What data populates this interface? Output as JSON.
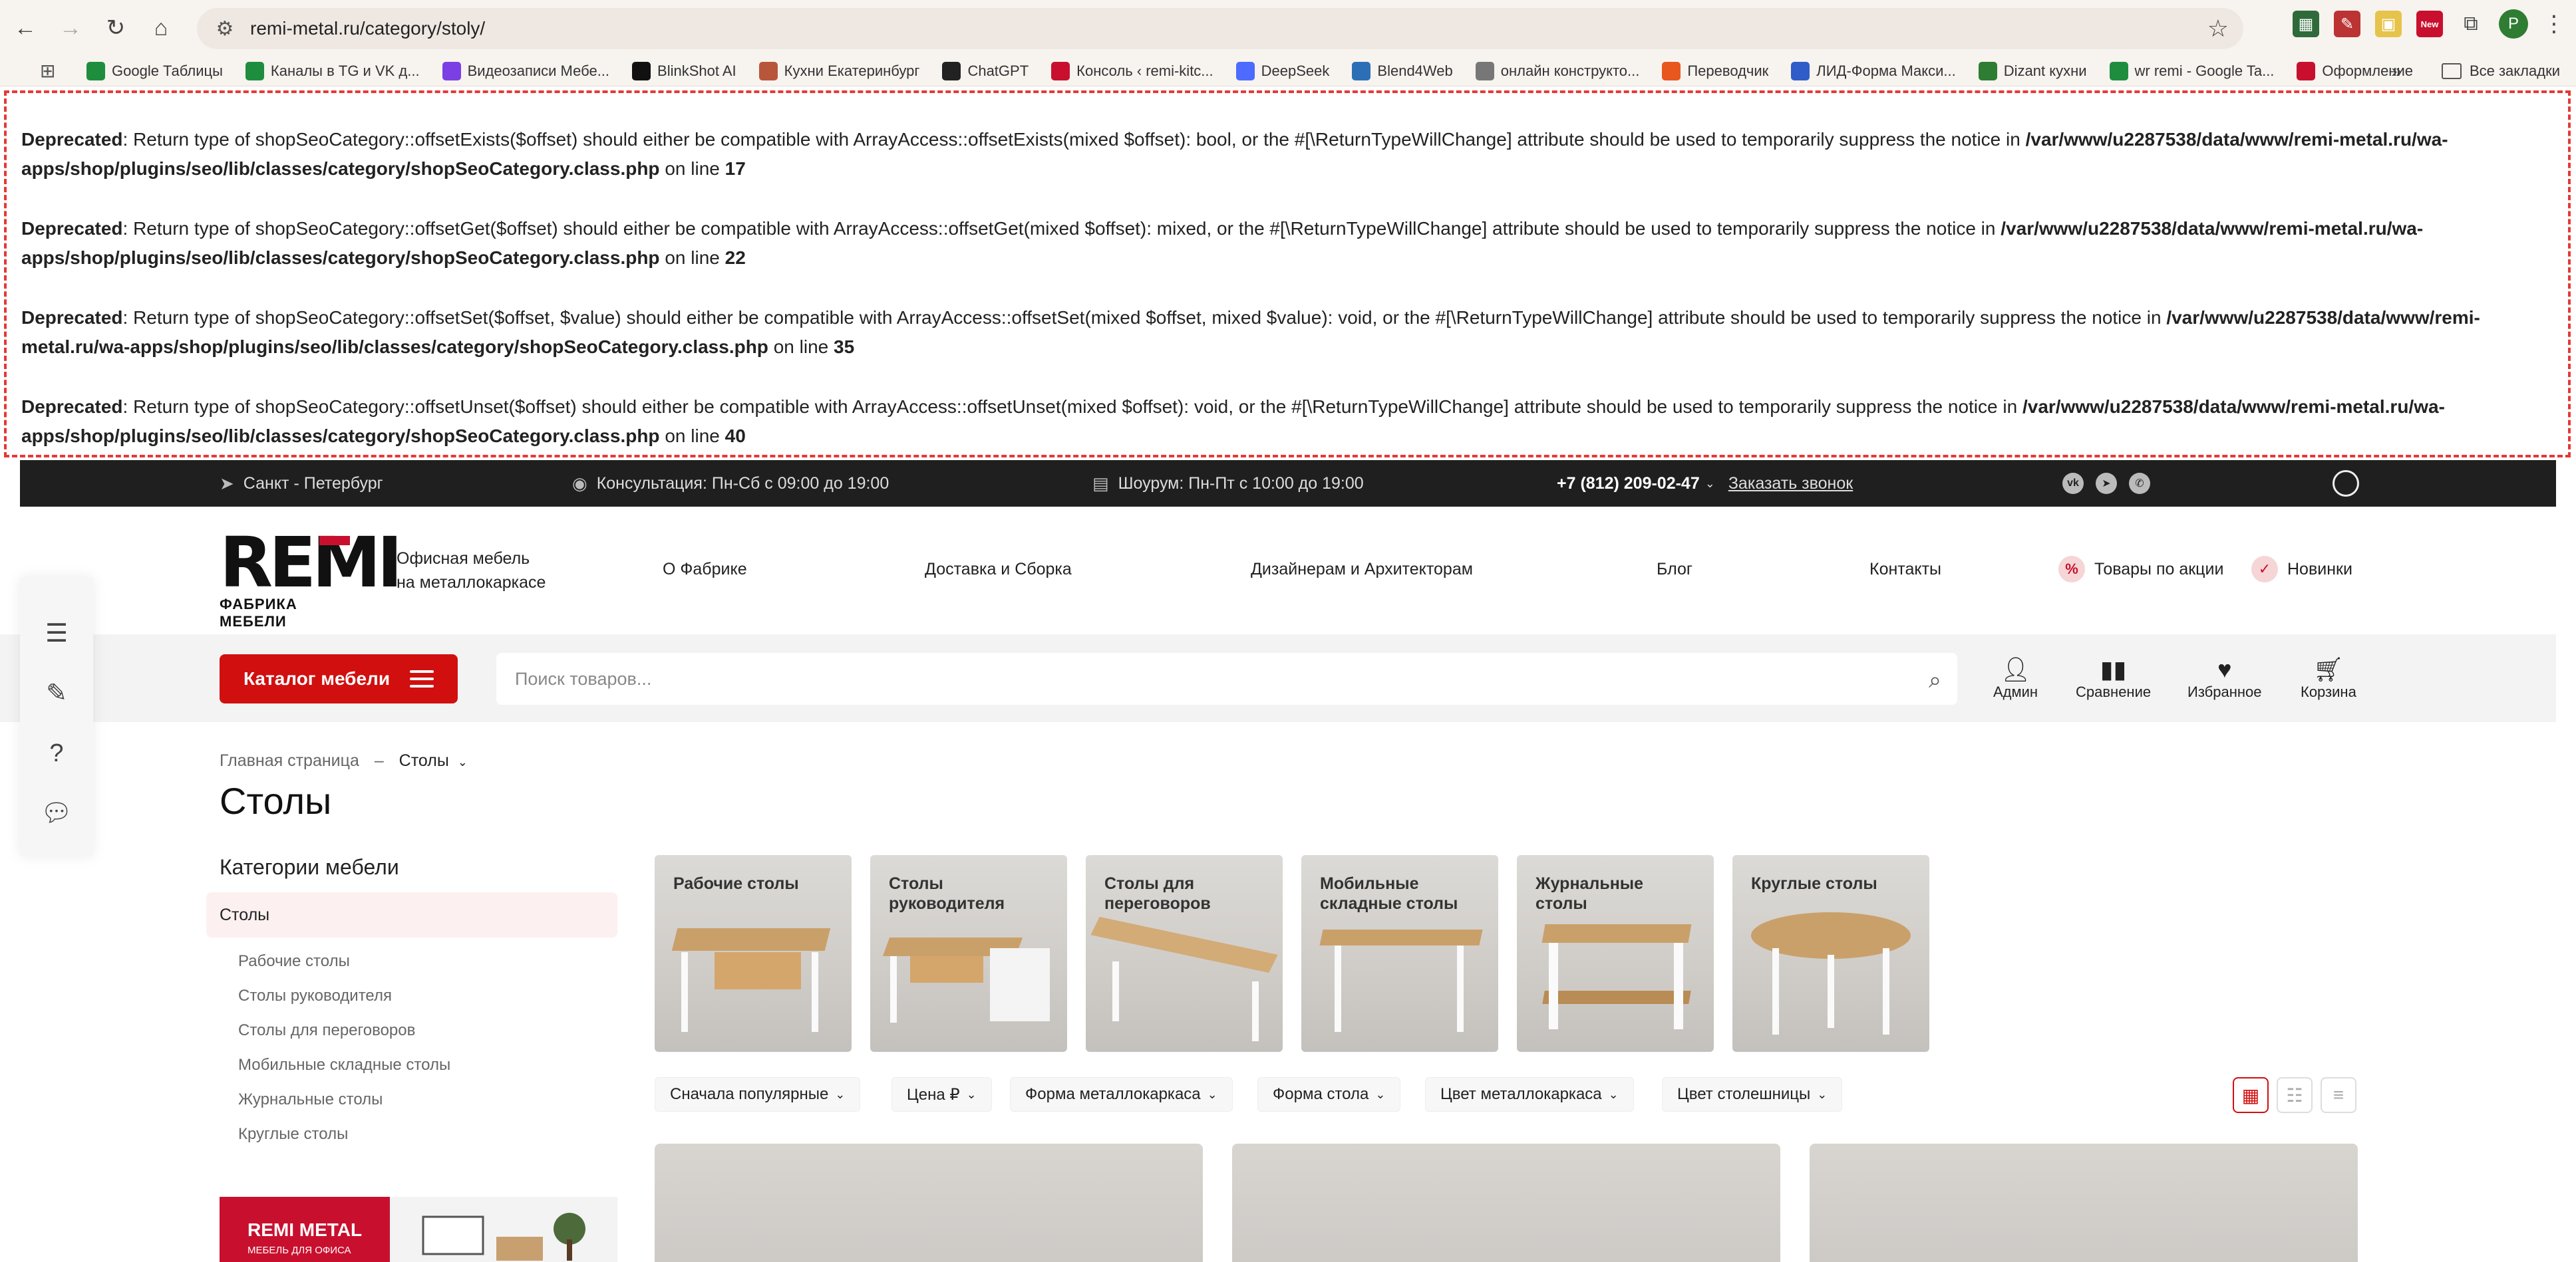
{
  "browser": {
    "url": "remi-metal.ru/category/stoly/",
    "profile_initial": "P",
    "ext_new_badge": "New",
    "bookmarks": [
      {
        "label": "Google Таблицы",
        "icon": "sheets-icon",
        "color": "#1e8e3e"
      },
      {
        "label": "Каналы в TG и VK д...",
        "icon": "sheets-icon",
        "color": "#1e8e3e"
      },
      {
        "label": "Видеозаписи Мебе...",
        "icon": "video-icon",
        "color": "#7b3fe4"
      },
      {
        "label": "BlinkShot AI",
        "icon": "blinkshot-icon",
        "color": "#111111"
      },
      {
        "label": "Кухни Екатеринбург",
        "icon": "kitchen-icon",
        "color": "#b8563c"
      },
      {
        "label": "ChatGPT",
        "icon": "chatgpt-icon",
        "color": "#222222"
      },
      {
        "label": "Консоль ‹ remi-kitc...",
        "icon": "rk-icon",
        "color": "#c8102e"
      },
      {
        "label": "DeepSeek",
        "icon": "deepseek-icon",
        "color": "#4d6bfe"
      },
      {
        "label": "Blend4Web",
        "icon": "blend4web-icon",
        "color": "#2d6fb6"
      },
      {
        "label": "онлайн конструкто...",
        "icon": "page-icon",
        "color": "#777777"
      },
      {
        "label": "Переводчик",
        "icon": "translate-icon",
        "color": "#e8571d"
      },
      {
        "label": "ЛИД-Форма Макси...",
        "icon": "lead-form-icon",
        "color": "#2f5cc8"
      },
      {
        "label": "Dizant кухни",
        "icon": "dizant-icon",
        "color": "#2e7d32"
      },
      {
        "label": "wr remi - Google Ta...",
        "icon": "sheets-icon",
        "color": "#1e8e3e"
      },
      {
        "label": "Оформление",
        "icon": "st-icon",
        "color": "#c8102e"
      }
    ],
    "all_bookmarks": "Все закладки"
  },
  "notices": [
    {
      "label": "Deprecated",
      "text": ": Return type of shopSeoCategory::offsetExists($offset) should either be compatible with ArrayAccess::offsetExists(mixed $offset): bool, or the #[\\ReturnTypeWillChange] attribute should be used to temporarily suppress the notice in ",
      "path": "/var/www/u2287538/data/www/remi-metal.ru/wa-apps/shop/plugins/seo/lib/classes/category/shopSeoCategory.class.php",
      "on_line": " on line ",
      "line": "17"
    },
    {
      "label": "Deprecated",
      "text": ": Return type of shopSeoCategory::offsetGet($offset) should either be compatible with ArrayAccess::offsetGet(mixed $offset): mixed, or the #[\\ReturnTypeWillChange] attribute should be used to temporarily suppress the notice in ",
      "path": "/var/www/u2287538/data/www/remi-metal.ru/wa-apps/shop/plugins/seo/lib/classes/category/shopSeoCategory.class.php",
      "on_line": " on line ",
      "line": "22"
    },
    {
      "label": "Deprecated",
      "text": ": Return type of shopSeoCategory::offsetSet($offset, $value) should either be compatible with ArrayAccess::offsetSet(mixed $offset, mixed $value): void, or the #[\\ReturnTypeWillChange] attribute should be used to temporarily suppress the notice in ",
      "path": "/var/www/u2287538/data/www/remi-metal.ru/wa-apps/shop/plugins/seo/lib/classes/category/shopSeoCategory.class.php",
      "on_line": " on line ",
      "line": "35"
    },
    {
      "label": "Deprecated",
      "text": ": Return type of shopSeoCategory::offsetUnset($offset) should either be compatible with ArrayAccess::offsetUnset(mixed $offset): void, or the #[\\ReturnTypeWillChange] attribute should be used to temporarily suppress the notice in ",
      "path": "/var/www/u2287538/data/www/remi-metal.ru/wa-apps/shop/plugins/seo/lib/classes/category/shopSeoCategory.class.php",
      "on_line": " on line ",
      "line": "40"
    }
  ],
  "topbar": {
    "city": "Санкт - Петербург",
    "consult": "Консультация: Пн-Сб с 09:00 до 19:00",
    "showroom": "Шоурум: Пн-Пт с 10:00 до 19:00",
    "phone": "+7 (812) 209-02-47",
    "callback": "Заказать звонок"
  },
  "header": {
    "logo_text": "REMI",
    "logo_sub": "ФАБРИКА МЕБЕЛИ",
    "tagline_1": "Офисная мебель",
    "tagline_2": "на металлокаркасе",
    "nav": [
      "О Фабрике",
      "Доставка и Сборка",
      "Дизайнерам и Архитекторам",
      "Блог",
      "Контакты"
    ],
    "promo_sale": "Товары по акции",
    "promo_new": "Новинки",
    "accent": "#d10f0f"
  },
  "search": {
    "catalog_label": "Каталог мебели",
    "placeholder": "Поиск товаров...",
    "icons": [
      {
        "label": "Админ",
        "icon": "user-icon"
      },
      {
        "label": "Сравнение",
        "icon": "compare-icon"
      },
      {
        "label": "Избранное",
        "icon": "heart-icon"
      },
      {
        "label": "Корзина",
        "icon": "cart-icon"
      }
    ]
  },
  "breadcrumb": {
    "home": "Главная страница",
    "sep": "–",
    "current": "Столы"
  },
  "page_title": "Столы",
  "sidebar": {
    "heading": "Категории мебели",
    "active": "Столы",
    "items": [
      "Рабочие столы",
      "Столы руководителя",
      "Столы для переговоров",
      "Мобильные складные столы",
      "Журнальные столы",
      "Круглые столы"
    ],
    "banner_title": "REMI METAL",
    "banner_sub": "МЕБЕЛЬ ДЛЯ ОФИСА"
  },
  "tiles": [
    "Рабочие столы",
    "Столы руководителя",
    "Столы для переговоров",
    "Мобильные складные столы",
    "Журнальные столы",
    "Круглые столы"
  ],
  "filters": [
    "Сначала популярные",
    "Цена ₽",
    "Форма металлокаркаса",
    "Форма стола",
    "Цвет металлокаркаса",
    "Цвет столешницы"
  ]
}
